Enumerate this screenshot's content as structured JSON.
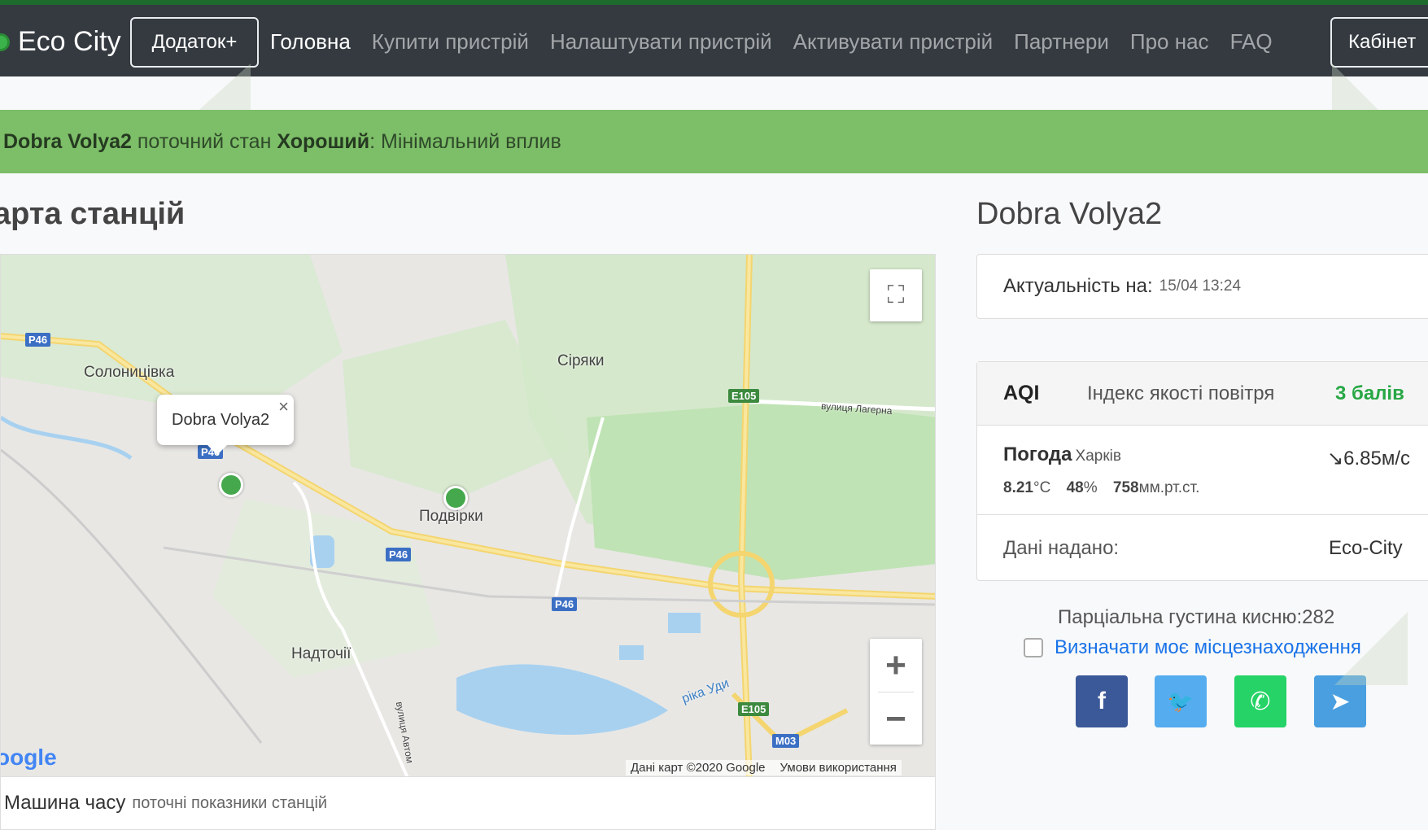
{
  "navbar": {
    "brand": "Eco City",
    "app_button": "Додаток+",
    "links": [
      "Головна",
      "Купити пристрій",
      "Налаштувати пристрій",
      "Активувати пристрій",
      "Партнери",
      "Про нас",
      "FAQ"
    ],
    "cabinet_button": "Кабінет"
  },
  "banner": {
    "station": "Dobra Volya2",
    "current_state_text": "поточний стан",
    "state": "Хороший",
    "separator": ":",
    "impact": "Мінімальний вплив"
  },
  "left": {
    "heading": "арта станцій",
    "map": {
      "popup_title": "Dobra Volya2",
      "popup_close": "×",
      "labels": {
        "solonytsivka": "Солоницівка",
        "siryaky": "Сіряки",
        "podvirky": "Подвірки",
        "nadtochii": "Надточії",
        "lahirna_street": "вулиця Лагерна",
        "river_udy": "ріка Уди",
        "avtom_street": "вулиця Автом"
      },
      "roads": {
        "p46_a": "P46",
        "p46_b": "P46",
        "p46_c": "P46",
        "p46_d": "P46",
        "e105_a": "E105",
        "e105_b": "E105",
        "m03": "M03"
      },
      "google_logo": "oogle",
      "credit_data": "Дані карт ©2020 Google",
      "credit_terms": "Умови використання",
      "zoom_in": "+",
      "zoom_out": "−"
    },
    "time_machine": {
      "title": "Машина часу",
      "subtitle": "поточні показники станцій"
    }
  },
  "right": {
    "station_title": "Dobra Volya2",
    "updated_label": "Актуальність на:",
    "updated_value": "15/04 13:24",
    "aqi": {
      "label": "AQI",
      "description": "Індекс якості повітря",
      "value": "3 балів"
    },
    "weather": {
      "label": "Погода",
      "city": "Харків",
      "wind": "↘6.85м/с",
      "temperature_value": "8.21",
      "temperature_unit": "°C",
      "humidity_value": "48",
      "humidity_unit": "%",
      "pressure_value": "758",
      "pressure_unit": "мм.рт.ст."
    },
    "source": {
      "label": "Дані надано:",
      "value": "Eco-City"
    },
    "oxygen_text": "Парціальна густина кисню:282",
    "geolocation_label": "Визначати моє місцезнаходження",
    "social": {
      "facebook": "f",
      "twitter": "🐦",
      "whatsapp": "✆",
      "telegram": "➤"
    }
  },
  "colors": {
    "navbar_bg": "#343a40",
    "banner_bg": "#7dbe68",
    "aqi_good": "#28a745",
    "link_blue": "#1a73e8"
  }
}
